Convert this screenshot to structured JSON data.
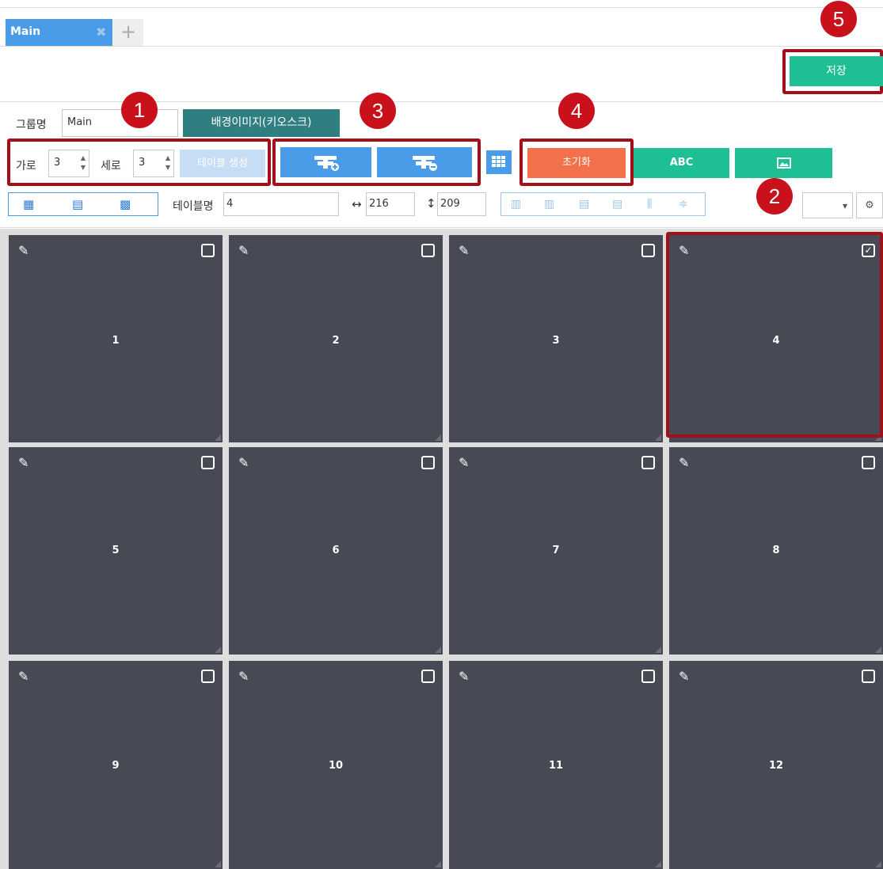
{
  "tabs": {
    "main_label": "Main",
    "close_glyph": "✖",
    "add_glyph": "+"
  },
  "badges": {
    "b1": "1",
    "b2": "2",
    "b3": "3",
    "b4": "4",
    "b5": "5"
  },
  "toolbar": {
    "save_label": "저장",
    "group_label": "그룹명",
    "group_value": "Main",
    "bg_button_label": "배경이미지(키오스크)",
    "cols_label": "가로",
    "cols_value": "3",
    "rows_label": "세로",
    "rows_value": "3",
    "create_table_label": "테이블 생성",
    "reset_label": "초기화",
    "abc_label": "ABC",
    "table_name_label": "테이블명",
    "table_name_value": "4",
    "width_value": "216",
    "height_value": "209",
    "width_arrow": "↔",
    "height_arrow": "↕",
    "dropdown_value": "",
    "dropdown_arrow": "▾",
    "settings_glyph": "⚙"
  },
  "tables": [
    {
      "number": "1",
      "checked": false
    },
    {
      "number": "2",
      "checked": false
    },
    {
      "number": "3",
      "checked": false
    },
    {
      "number": "4",
      "checked": true
    },
    {
      "number": "5",
      "checked": false
    },
    {
      "number": "6",
      "checked": false
    },
    {
      "number": "7",
      "checked": false
    },
    {
      "number": "8",
      "checked": false
    },
    {
      "number": "9",
      "checked": false
    },
    {
      "number": "10",
      "checked": false
    },
    {
      "number": "11",
      "checked": false
    },
    {
      "number": "12",
      "checked": false
    }
  ],
  "colors": {
    "accent_blue": "#4a9be8",
    "teal": "#1fbf95",
    "dark_teal": "#2f7f80",
    "orange": "#f2704a",
    "badge_red": "#c8111b",
    "highlight_red": "#a30f18",
    "cell_bg": "#474a55"
  },
  "icons": {
    "edit": "pencil-icon",
    "checkbox": "checkbox-icon",
    "add_table": "table-add-icon",
    "remove_table": "table-remove-icon",
    "grid": "grid-icon",
    "image": "image-icon",
    "settings": "gear-icon"
  }
}
